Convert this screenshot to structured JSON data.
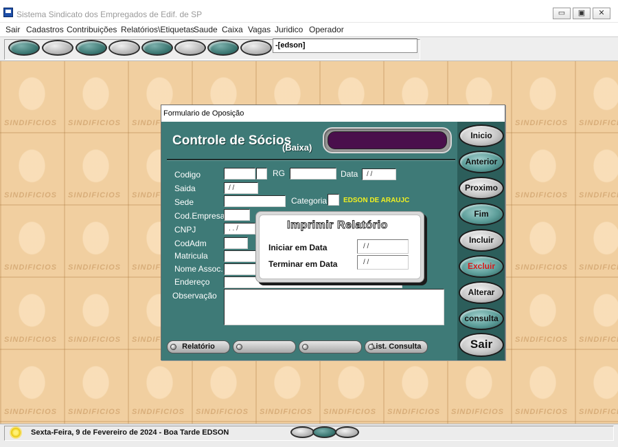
{
  "window": {
    "title": "Sistema Sindicato dos Empregados de Edif. de SP",
    "controls": {
      "minimize": "▭",
      "maximize": "▣",
      "close": "✕"
    }
  },
  "menu": [
    "Sair",
    "Cadastros",
    "Contribuições",
    "Relatórios\\Etiquetas",
    "Saude",
    "Caixa",
    "Vagas",
    "Juridico",
    "Operador"
  ],
  "toolbar": {
    "user": "-[edson]",
    "buttons": [
      "teal",
      "gray",
      "teal",
      "gray",
      "teal",
      "gray",
      "teal",
      "gray"
    ]
  },
  "background": {
    "watermark_text": "SINDIFICIOS"
  },
  "dialog": {
    "title": "Formulario de Oposição",
    "header": {
      "title": "Controle de Sócios",
      "subtitle": "(Baixa)"
    },
    "fields": {
      "codigo": {
        "label": "Codigo",
        "value": ""
      },
      "rg": {
        "label": "RG",
        "value": ""
      },
      "data": {
        "label": "Data",
        "value": " /  /"
      },
      "saida": {
        "label": "Saida",
        "value": " /  /"
      },
      "sede": {
        "label": "Sede",
        "value": ""
      },
      "categoria": {
        "label": "Categoria",
        "value": "",
        "name": "EDSON DE ARAUJC"
      },
      "cod_empresa": {
        "label": "Cod.Empresa",
        "value": ""
      },
      "cnpj": {
        "label": "CNPJ",
        "value": "  .    .   /"
      },
      "cod_adm": {
        "label": "CodAdm",
        "value": ""
      },
      "matricula": {
        "label": "Matricula",
        "value": ""
      },
      "nome_assoc": {
        "label": "Nome Assoc.",
        "value": ""
      },
      "endereco": {
        "label": "Endereço",
        "value": ""
      },
      "observacao": {
        "label": "Observação",
        "value": ""
      }
    },
    "bottom_buttons": [
      "Relatório",
      "",
      "",
      "List. Consulta"
    ],
    "nav_buttons": [
      "Inicio",
      "Anterior",
      "Proximo",
      "Fim",
      "Incluir",
      "Excluir",
      "Alterar",
      "consulta",
      "Sair"
    ]
  },
  "print_dialog": {
    "title": "Imprimir Relatório",
    "start_label": "Iniciar em Data",
    "start_value": " /  /",
    "end_label": "Terminar em Data",
    "end_value": " /  /"
  },
  "status": {
    "text": "Sexta-Feira,  9 de Fevereiro de 2024 - Boa Tarde  EDSON",
    "ovals": [
      "gray",
      "teal",
      "gray"
    ]
  }
}
